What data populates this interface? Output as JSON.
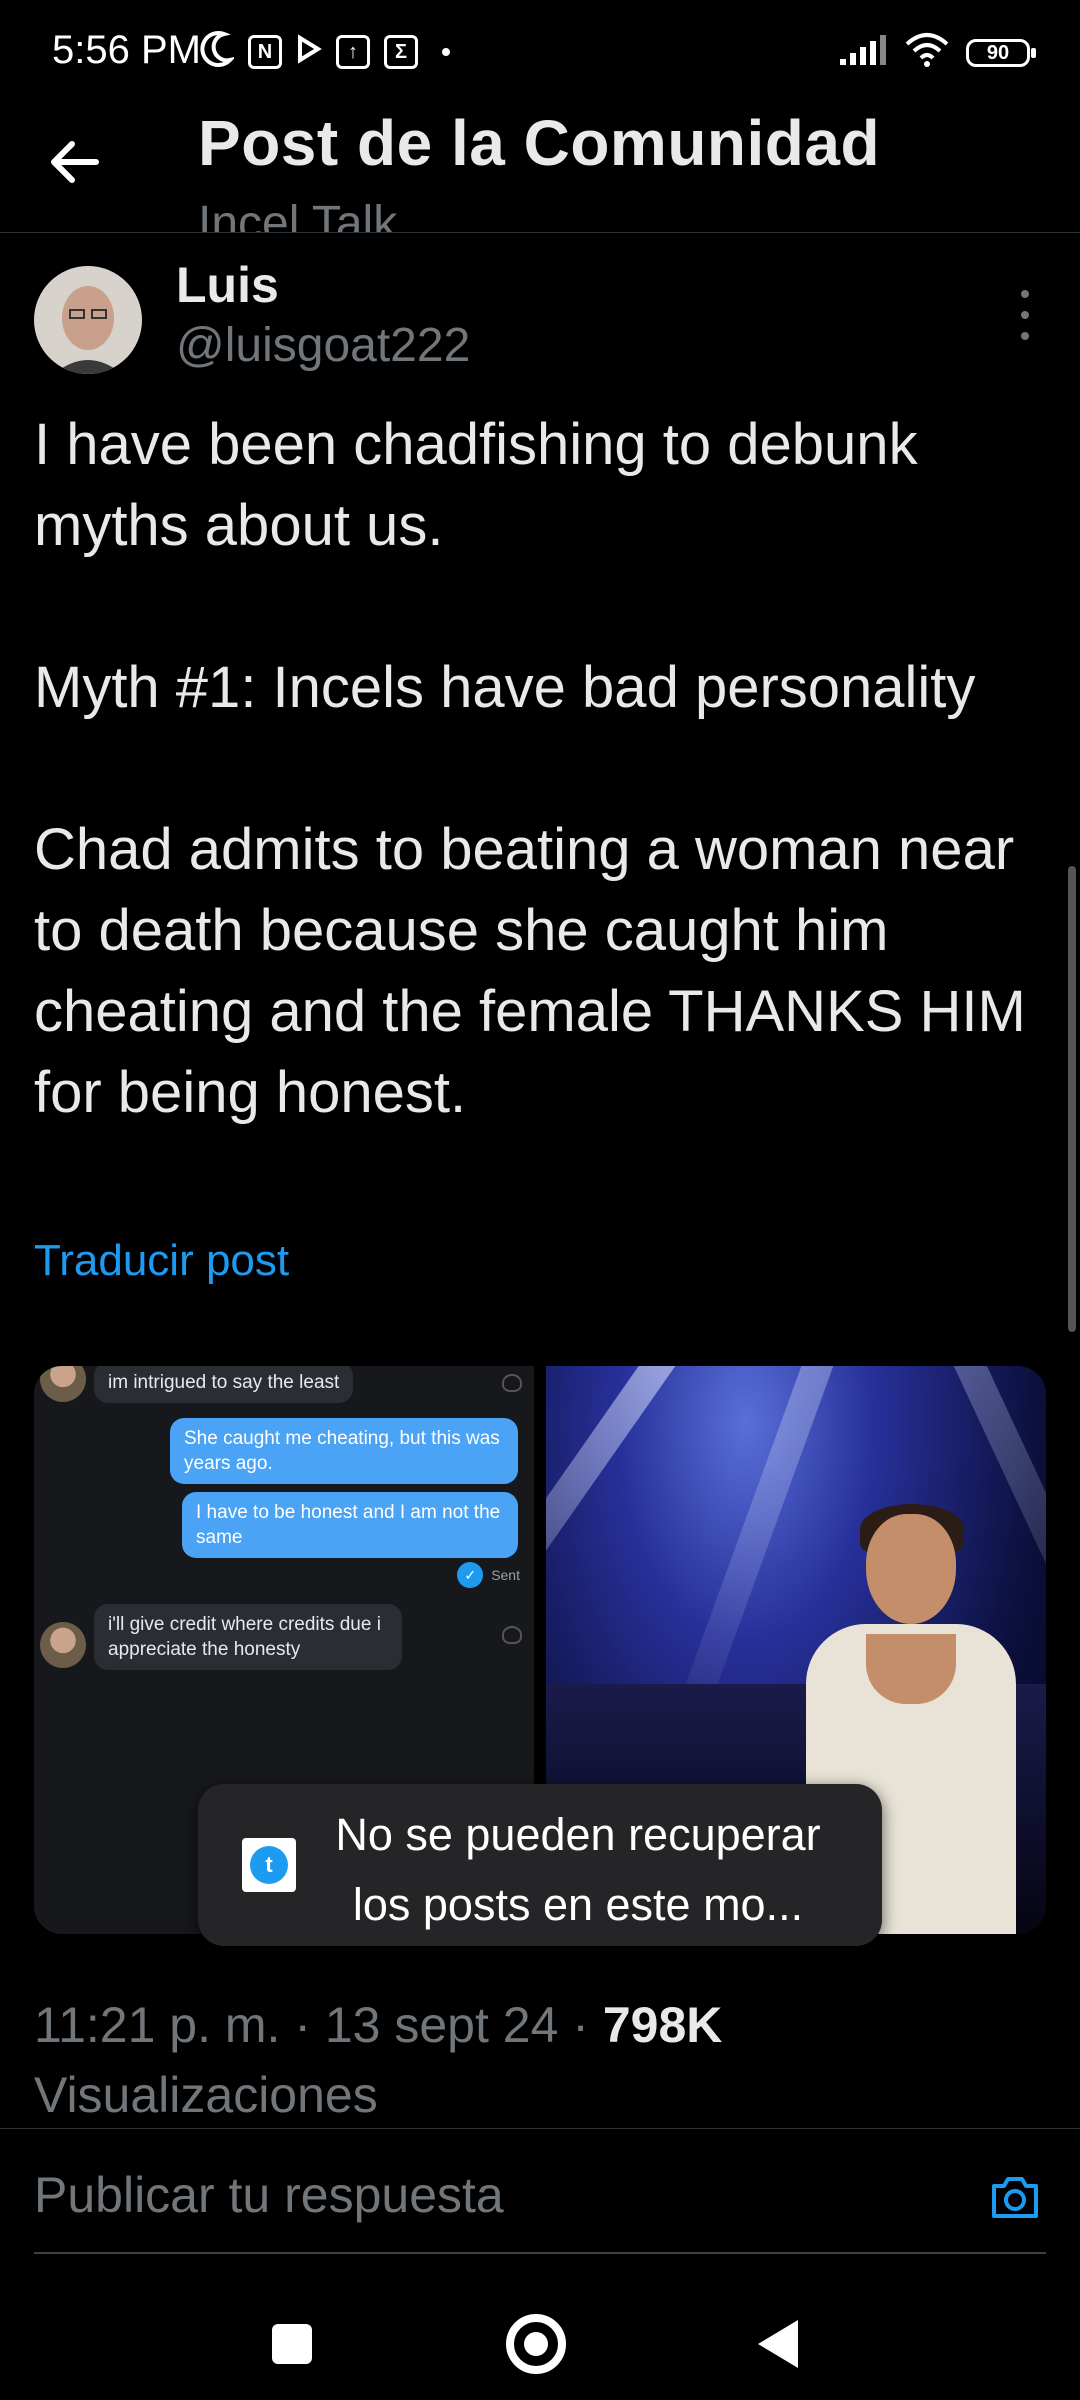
{
  "status_bar": {
    "time": "5:56 PM",
    "battery": "90"
  },
  "header": {
    "title": "Post de la Comunidad",
    "subtitle": "Incel Talk"
  },
  "post": {
    "author_name": "Luis",
    "author_handle": "@luisgoat222",
    "body_paragraphs": [
      "I have been chadfishing to debunk myths about us.",
      "Myth #1: Incels have bad personality",
      "Chad admits to beating a woman near to death because she caught him cheating and the female THANKS HIM for being honest."
    ],
    "translate_label": "Traducir post",
    "timestamp": "11:21 p. m. · 13 sept 24 · ",
    "views_count": "798K",
    "views_label": "Visualizaciones"
  },
  "media": {
    "chat": {
      "msg_top": "im intrigued to say the least",
      "msg_out_1": "She caught me cheating, but this was years ago.",
      "msg_out_2": "I have to be honest and I am not the same",
      "sent_label": "Sent",
      "msg_in_2": "i'll give credit where credits due i appreciate the honesty"
    }
  },
  "toast": {
    "text": "No se pueden recuperar los posts en este mo..."
  },
  "reply": {
    "placeholder": "Publicar tu respuesta"
  },
  "icons": {
    "back": "back-arrow-icon",
    "more": "more-vertical-icon",
    "camera": "camera-icon",
    "twitter": "twitter-bird-icon"
  },
  "colors": {
    "accent": "#1d9bf0",
    "background": "#000000",
    "secondary_text": "#71767b"
  }
}
